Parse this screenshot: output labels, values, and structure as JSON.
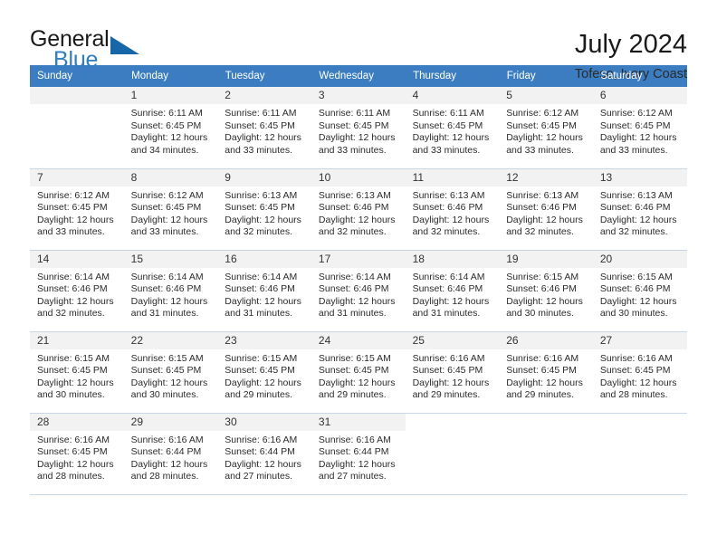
{
  "brand": {
    "line1": "General",
    "line2": "Blue",
    "triangle_icon": "triangle-icon",
    "accent_color": "#1767a8",
    "blue_text_color": "#2e7ec1"
  },
  "header": {
    "title": "July 2024",
    "subtitle": "Tofeso, Ivory Coast"
  },
  "calendar": {
    "header_bg": "#3b7dc0",
    "daynum_bg": "#f2f2f2",
    "weekdays": [
      "Sunday",
      "Monday",
      "Tuesday",
      "Wednesday",
      "Thursday",
      "Friday",
      "Saturday"
    ],
    "weeks": [
      [
        {
          "day": "",
          "sunrise": "",
          "sunset": "",
          "daylight1": "",
          "daylight2": "",
          "empty": true
        },
        {
          "day": "1",
          "sunrise": "Sunrise: 6:11 AM",
          "sunset": "Sunset: 6:45 PM",
          "daylight1": "Daylight: 12 hours",
          "daylight2": "and 34 minutes."
        },
        {
          "day": "2",
          "sunrise": "Sunrise: 6:11 AM",
          "sunset": "Sunset: 6:45 PM",
          "daylight1": "Daylight: 12 hours",
          "daylight2": "and 33 minutes."
        },
        {
          "day": "3",
          "sunrise": "Sunrise: 6:11 AM",
          "sunset": "Sunset: 6:45 PM",
          "daylight1": "Daylight: 12 hours",
          "daylight2": "and 33 minutes."
        },
        {
          "day": "4",
          "sunrise": "Sunrise: 6:11 AM",
          "sunset": "Sunset: 6:45 PM",
          "daylight1": "Daylight: 12 hours",
          "daylight2": "and 33 minutes."
        },
        {
          "day": "5",
          "sunrise": "Sunrise: 6:12 AM",
          "sunset": "Sunset: 6:45 PM",
          "daylight1": "Daylight: 12 hours",
          "daylight2": "and 33 minutes."
        },
        {
          "day": "6",
          "sunrise": "Sunrise: 6:12 AM",
          "sunset": "Sunset: 6:45 PM",
          "daylight1": "Daylight: 12 hours",
          "daylight2": "and 33 minutes."
        }
      ],
      [
        {
          "day": "7",
          "sunrise": "Sunrise: 6:12 AM",
          "sunset": "Sunset: 6:45 PM",
          "daylight1": "Daylight: 12 hours",
          "daylight2": "and 33 minutes."
        },
        {
          "day": "8",
          "sunrise": "Sunrise: 6:12 AM",
          "sunset": "Sunset: 6:45 PM",
          "daylight1": "Daylight: 12 hours",
          "daylight2": "and 33 minutes."
        },
        {
          "day": "9",
          "sunrise": "Sunrise: 6:13 AM",
          "sunset": "Sunset: 6:45 PM",
          "daylight1": "Daylight: 12 hours",
          "daylight2": "and 32 minutes."
        },
        {
          "day": "10",
          "sunrise": "Sunrise: 6:13 AM",
          "sunset": "Sunset: 6:46 PM",
          "daylight1": "Daylight: 12 hours",
          "daylight2": "and 32 minutes."
        },
        {
          "day": "11",
          "sunrise": "Sunrise: 6:13 AM",
          "sunset": "Sunset: 6:46 PM",
          "daylight1": "Daylight: 12 hours",
          "daylight2": "and 32 minutes."
        },
        {
          "day": "12",
          "sunrise": "Sunrise: 6:13 AM",
          "sunset": "Sunset: 6:46 PM",
          "daylight1": "Daylight: 12 hours",
          "daylight2": "and 32 minutes."
        },
        {
          "day": "13",
          "sunrise": "Sunrise: 6:13 AM",
          "sunset": "Sunset: 6:46 PM",
          "daylight1": "Daylight: 12 hours",
          "daylight2": "and 32 minutes."
        }
      ],
      [
        {
          "day": "14",
          "sunrise": "Sunrise: 6:14 AM",
          "sunset": "Sunset: 6:46 PM",
          "daylight1": "Daylight: 12 hours",
          "daylight2": "and 32 minutes."
        },
        {
          "day": "15",
          "sunrise": "Sunrise: 6:14 AM",
          "sunset": "Sunset: 6:46 PM",
          "daylight1": "Daylight: 12 hours",
          "daylight2": "and 31 minutes."
        },
        {
          "day": "16",
          "sunrise": "Sunrise: 6:14 AM",
          "sunset": "Sunset: 6:46 PM",
          "daylight1": "Daylight: 12 hours",
          "daylight2": "and 31 minutes."
        },
        {
          "day": "17",
          "sunrise": "Sunrise: 6:14 AM",
          "sunset": "Sunset: 6:46 PM",
          "daylight1": "Daylight: 12 hours",
          "daylight2": "and 31 minutes."
        },
        {
          "day": "18",
          "sunrise": "Sunrise: 6:14 AM",
          "sunset": "Sunset: 6:46 PM",
          "daylight1": "Daylight: 12 hours",
          "daylight2": "and 31 minutes."
        },
        {
          "day": "19",
          "sunrise": "Sunrise: 6:15 AM",
          "sunset": "Sunset: 6:46 PM",
          "daylight1": "Daylight: 12 hours",
          "daylight2": "and 30 minutes."
        },
        {
          "day": "20",
          "sunrise": "Sunrise: 6:15 AM",
          "sunset": "Sunset: 6:46 PM",
          "daylight1": "Daylight: 12 hours",
          "daylight2": "and 30 minutes."
        }
      ],
      [
        {
          "day": "21",
          "sunrise": "Sunrise: 6:15 AM",
          "sunset": "Sunset: 6:45 PM",
          "daylight1": "Daylight: 12 hours",
          "daylight2": "and 30 minutes."
        },
        {
          "day": "22",
          "sunrise": "Sunrise: 6:15 AM",
          "sunset": "Sunset: 6:45 PM",
          "daylight1": "Daylight: 12 hours",
          "daylight2": "and 30 minutes."
        },
        {
          "day": "23",
          "sunrise": "Sunrise: 6:15 AM",
          "sunset": "Sunset: 6:45 PM",
          "daylight1": "Daylight: 12 hours",
          "daylight2": "and 29 minutes."
        },
        {
          "day": "24",
          "sunrise": "Sunrise: 6:15 AM",
          "sunset": "Sunset: 6:45 PM",
          "daylight1": "Daylight: 12 hours",
          "daylight2": "and 29 minutes."
        },
        {
          "day": "25",
          "sunrise": "Sunrise: 6:16 AM",
          "sunset": "Sunset: 6:45 PM",
          "daylight1": "Daylight: 12 hours",
          "daylight2": "and 29 minutes."
        },
        {
          "day": "26",
          "sunrise": "Sunrise: 6:16 AM",
          "sunset": "Sunset: 6:45 PM",
          "daylight1": "Daylight: 12 hours",
          "daylight2": "and 29 minutes."
        },
        {
          "day": "27",
          "sunrise": "Sunrise: 6:16 AM",
          "sunset": "Sunset: 6:45 PM",
          "daylight1": "Daylight: 12 hours",
          "daylight2": "and 28 minutes."
        }
      ],
      [
        {
          "day": "28",
          "sunrise": "Sunrise: 6:16 AM",
          "sunset": "Sunset: 6:45 PM",
          "daylight1": "Daylight: 12 hours",
          "daylight2": "and 28 minutes."
        },
        {
          "day": "29",
          "sunrise": "Sunrise: 6:16 AM",
          "sunset": "Sunset: 6:44 PM",
          "daylight1": "Daylight: 12 hours",
          "daylight2": "and 28 minutes."
        },
        {
          "day": "30",
          "sunrise": "Sunrise: 6:16 AM",
          "sunset": "Sunset: 6:44 PM",
          "daylight1": "Daylight: 12 hours",
          "daylight2": "and 27 minutes."
        },
        {
          "day": "31",
          "sunrise": "Sunrise: 6:16 AM",
          "sunset": "Sunset: 6:44 PM",
          "daylight1": "Daylight: 12 hours",
          "daylight2": "and 27 minutes."
        },
        {
          "day": "",
          "sunrise": "",
          "sunset": "",
          "daylight1": "",
          "daylight2": "",
          "empty": true,
          "blank": true
        },
        {
          "day": "",
          "sunrise": "",
          "sunset": "",
          "daylight1": "",
          "daylight2": "",
          "empty": true,
          "blank": true
        },
        {
          "day": "",
          "sunrise": "",
          "sunset": "",
          "daylight1": "",
          "daylight2": "",
          "empty": true,
          "blank": true
        }
      ]
    ]
  }
}
